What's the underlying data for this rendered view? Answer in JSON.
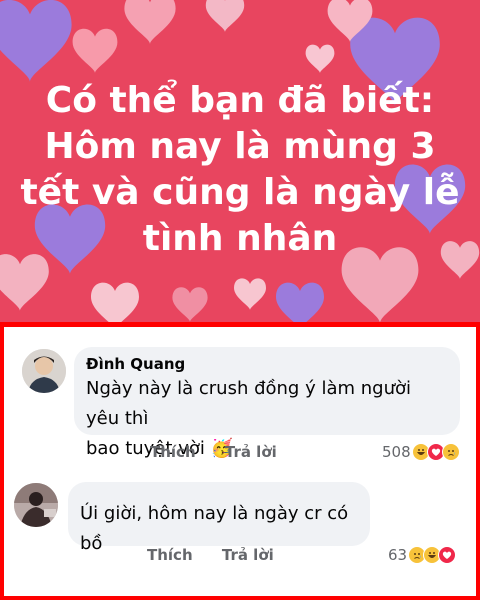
{
  "post": {
    "line1": "Có thể bạn đã biết:",
    "line2": "Hôm nay là mùng 3",
    "line3": "tết và cũng là ngày lễ",
    "line4": "tình nhân"
  },
  "comments": [
    {
      "author": "Đình Quang",
      "text_line1": "Ngày này là crush đồng ý làm người yêu thì",
      "text_line2": "bao tuyệt vời",
      "emoji": "🥳",
      "like_label": "Thích",
      "reply_label": "Trả lời",
      "reaction_count": "508",
      "reactions": [
        "haha",
        "love",
        "sad"
      ]
    },
    {
      "author": "",
      "text_line1": "Úi giời, hôm nay là ngày cr có bồ",
      "like_label": "Thích",
      "reply_label": "Trả lời",
      "reaction_count": "63",
      "reactions": [
        "sad",
        "haha",
        "love"
      ]
    }
  ],
  "colors": {
    "post_background": "#e8455f",
    "highlight_border": "#ff0000",
    "bubble": "#f0f2f5"
  }
}
